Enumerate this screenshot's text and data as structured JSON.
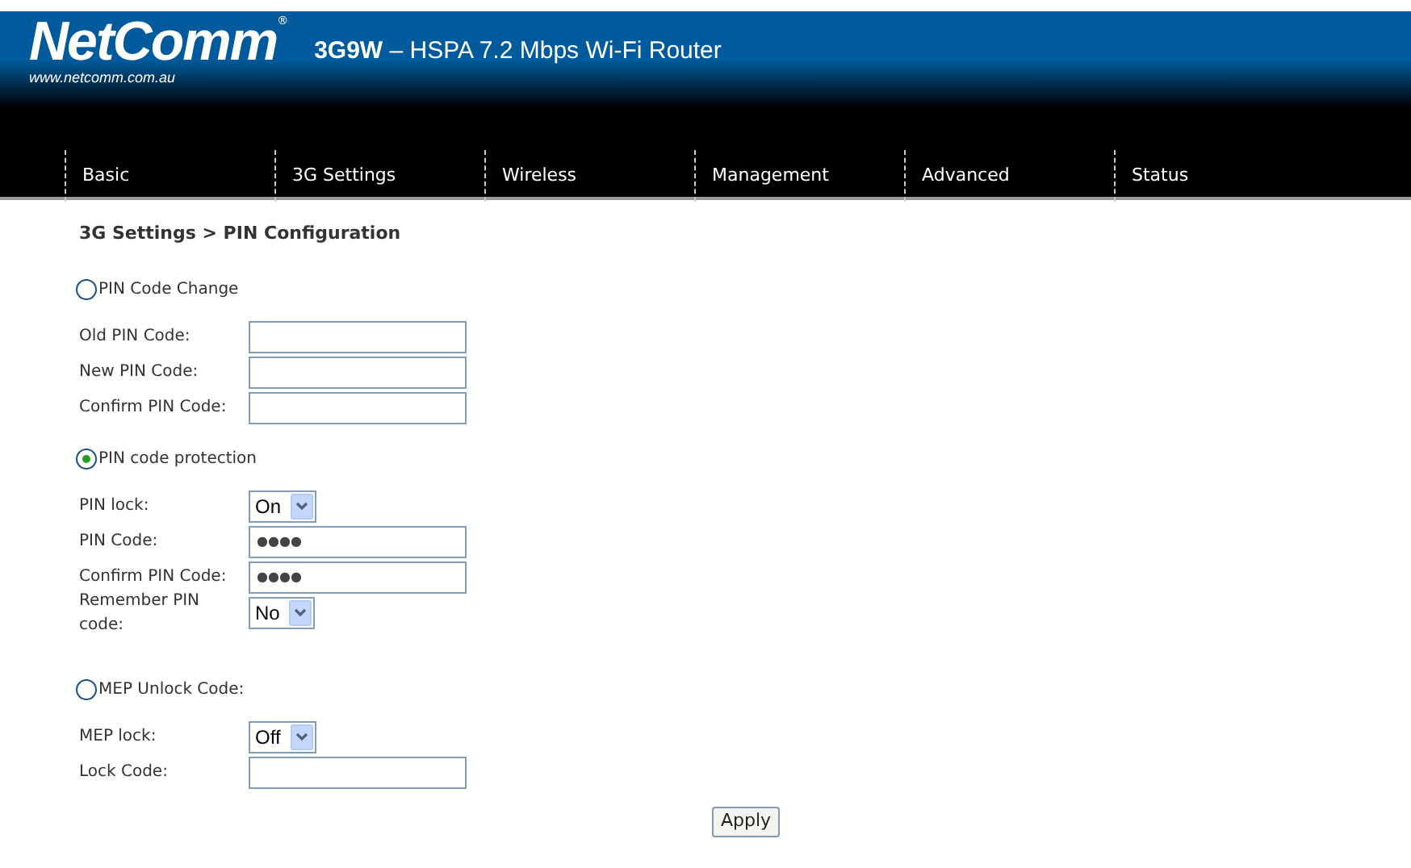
{
  "header": {
    "logo": "NetComm",
    "logo_mark": "®",
    "logo_url": "www.netcomm.com.au",
    "title_model": "3G9W",
    "title_rest": " – HSPA 7.2 Mbps Wi-Fi Router"
  },
  "nav": [
    {
      "label": "Basic",
      "selected": false
    },
    {
      "label": "3G Settings",
      "selected": false
    },
    {
      "label": "Wireless",
      "selected": false
    },
    {
      "label": "Management",
      "selected": false
    },
    {
      "label": "Advanced",
      "selected": false
    },
    {
      "label": "Status",
      "selected": false
    }
  ],
  "breadcrumb": "3G Settings > PIN Configuration",
  "sections": [
    {
      "label": "PIN Code Change",
      "selected": false,
      "fields": [
        {
          "label": "Old PIN Code:",
          "kind": "text"
        },
        {
          "label": "New PIN Code:",
          "kind": "text"
        },
        {
          "label": "Confirm PIN Code:",
          "kind": "text"
        }
      ]
    },
    {
      "label": "PIN code protection",
      "selected": true,
      "fields": [
        {
          "label": "PIN lock:",
          "kind": "select",
          "value": "On"
        },
        {
          "label": "PIN Code:",
          "kind": "password",
          "value": "●●●●"
        },
        {
          "label": "Confirm PIN Code:",
          "kind": "password",
          "value": "●●●●"
        },
        {
          "label": "Remember PIN code:",
          "kind": "select",
          "value": "No"
        }
      ]
    },
    {
      "label": "MEP Unlock Code:",
      "selected": false,
      "fields": [
        {
          "label": "MEP lock:",
          "kind": "select",
          "value": "Off"
        },
        {
          "label": "Lock Code:",
          "kind": "text"
        }
      ]
    }
  ],
  "apply_button": "Apply"
}
